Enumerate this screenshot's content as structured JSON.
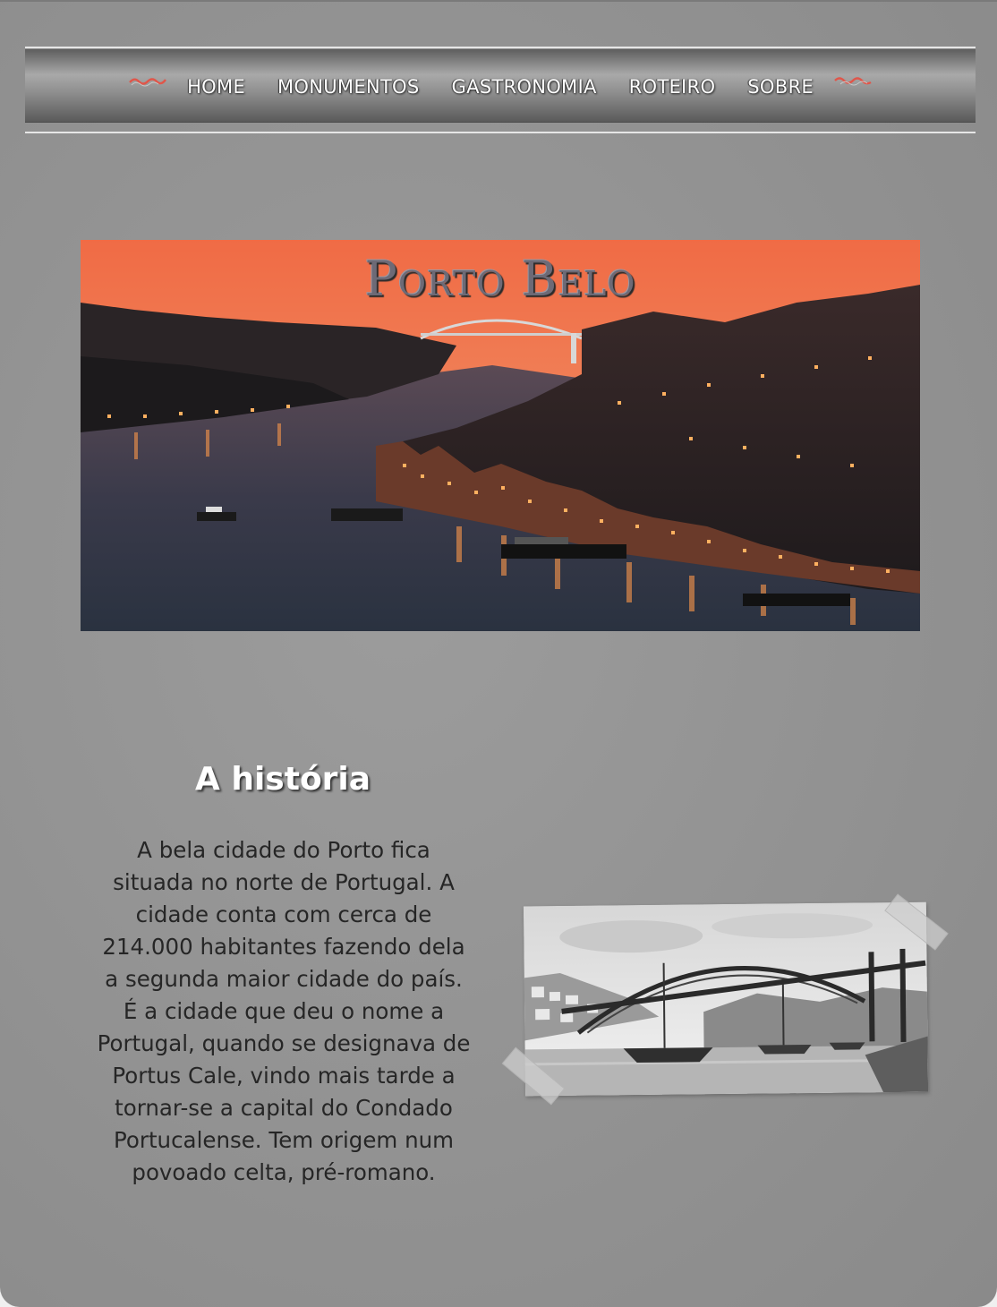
{
  "nav": {
    "items": [
      "HOME",
      "MONUMENTOS",
      "GASTRONOMIA",
      "ROTEIRO",
      "SOBRE"
    ]
  },
  "hero": {
    "title": "Porto Belo"
  },
  "history": {
    "title": "A história",
    "text": "A bela cidade do Porto fica situada no norte de Portugal. A cidade conta com cerca de 214.000 habitantes fazendo dela a segunda maior cidade do país. É a cidade que deu o nome a Portugal, quando se designava de Portus Cale, vindo mais tarde a tornar-se a capital do Condado Portucalense. Tem origem num povoado celta, pré-romano."
  },
  "colors": {
    "accent": "#e0564a",
    "background": "#929292",
    "hero_sky": "#ef7c52"
  }
}
